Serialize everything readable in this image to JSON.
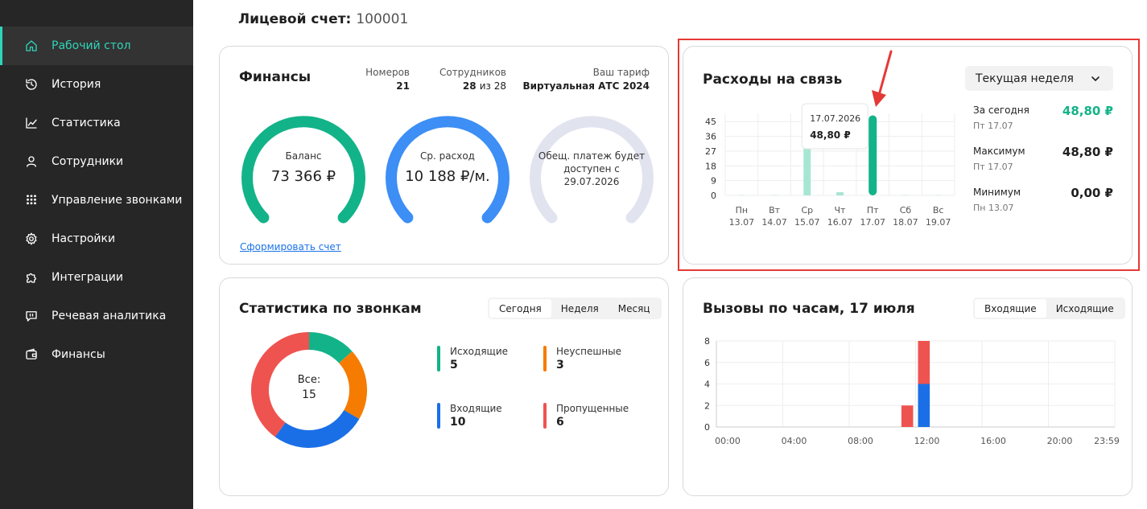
{
  "sidebar": {
    "items": [
      {
        "label": "Рабочий стол",
        "icon": "home-icon",
        "active": true
      },
      {
        "label": "История",
        "icon": "history-icon"
      },
      {
        "label": "Статистика",
        "icon": "chart-icon"
      },
      {
        "label": "Сотрудники",
        "icon": "user-icon"
      },
      {
        "label": "Управление звонками",
        "icon": "dialpad-icon"
      },
      {
        "label": "Настройки",
        "icon": "gear-icon"
      },
      {
        "label": "Интеграции",
        "icon": "puzzle-icon"
      },
      {
        "label": "Речевая аналитика",
        "icon": "speech-icon"
      },
      {
        "label": "Финансы",
        "icon": "wallet-icon"
      }
    ],
    "bg_color": "#262626",
    "accent_color": "#2fd4b8"
  },
  "account": {
    "label": "Лицевой счет:",
    "number": "100001"
  },
  "finance": {
    "title": "Финансы",
    "numbers_label": "Номеров",
    "numbers_value": "21",
    "employees_label": "Сотрудников",
    "employees_value": "28",
    "employees_of": "из 28",
    "tariff_label": "Ваш тариф",
    "tariff_value": "Виртуальная АТС 2024",
    "balance_label": "Баланс",
    "balance_value": "73 366 ₽",
    "avg_label": "Ср. расход",
    "avg_value": "10 188 ₽/м.",
    "payment_text_1": "Обещ. платеж будет",
    "payment_text_2": "доступен с",
    "payment_text_3": "29.07.2026",
    "invoice_link": "Сформировать счет",
    "colors": {
      "balance": "#12b388",
      "avg": "#3d8ef5",
      "payment": "#e1e3ef"
    }
  },
  "expenses": {
    "title": "Расходы на связь",
    "period_select": "Текущая неделя",
    "today_label": "За сегодня",
    "today_date": "Пт 17.07",
    "today_value": "48,80 ₽",
    "max_label": "Максимум",
    "max_date": "Пт 17.07",
    "max_value": "48,80 ₽",
    "min_label": "Минимум",
    "min_date": "Пн 13.07",
    "min_value": "0,00 ₽",
    "tooltip_date": "17.07.2026",
    "tooltip_value": "48,80 ₽",
    "accent_color": "#12b388",
    "highlight_color": "#e53935"
  },
  "call_stats": {
    "title": "Статистика по звонкам",
    "tabs": [
      "Сегодня",
      "Неделя",
      "Месяц"
    ],
    "active_tab": 0,
    "total_label": "Все:",
    "total_value": "15",
    "legend": [
      {
        "name": "Исходящие",
        "value": "5",
        "color": "#12b388"
      },
      {
        "name": "Неуспешные",
        "value": "3",
        "color": "#f57c00"
      },
      {
        "name": "Входящие",
        "value": "10",
        "color": "#1a6fe6"
      },
      {
        "name": "Пропущенные",
        "value": "6",
        "color": "#ef5350"
      }
    ]
  },
  "hourly": {
    "title": "Вызовы по часам, 17 июля",
    "tabs": [
      "Входящие",
      "Исходящие"
    ],
    "active_tab": 0
  },
  "chart_data": [
    {
      "type": "bar",
      "categories": [
        "Пн 13.07",
        "Вт 14.07",
        "Ср 15.07",
        "Чт 16.07",
        "Пт 17.07",
        "Сб 18.07",
        "Вс 19.07"
      ],
      "category_lines": [
        [
          "Пн",
          "13.07"
        ],
        [
          "Вт",
          "14.07"
        ],
        [
          "Ср",
          "15.07"
        ],
        [
          "Чт",
          "16.07"
        ],
        [
          "Пт",
          "17.07"
        ],
        [
          "Сб",
          "18.07"
        ],
        [
          "Вс",
          "19.07"
        ]
      ],
      "values": [
        0,
        0,
        34,
        2,
        48.8,
        0,
        0
      ],
      "yticks": [
        0,
        9,
        18,
        27,
        36,
        45
      ],
      "ylim": [
        0,
        50
      ],
      "grid": true,
      "colors": {
        "default": "#a8e6d4",
        "selected": "#12b388"
      },
      "selected_index": 4
    },
    {
      "type": "pie",
      "donut": true,
      "labels": [
        "Исходящие",
        "Неуспешные",
        "Входящие",
        "Пропущенные"
      ],
      "values": [
        2,
        3,
        4,
        6
      ],
      "colors": [
        "#12b388",
        "#f57c00",
        "#1a6fe6",
        "#ef5350"
      ]
    },
    {
      "type": "bar",
      "stacked": true,
      "xticks": [
        "00:00",
        "04:00",
        "08:00",
        "12:00",
        "16:00",
        "20:00",
        "23:59"
      ],
      "yticks": [
        0,
        2,
        4,
        6,
        8
      ],
      "ylim": [
        0,
        8
      ],
      "x_hours": [
        11,
        12
      ],
      "series": [
        {
          "values": [
            0,
            4
          ],
          "color": "#1a6fe6"
        },
        {
          "values": [
            2,
            4
          ],
          "color": "#ef5350"
        }
      ],
      "grid": true
    }
  ]
}
